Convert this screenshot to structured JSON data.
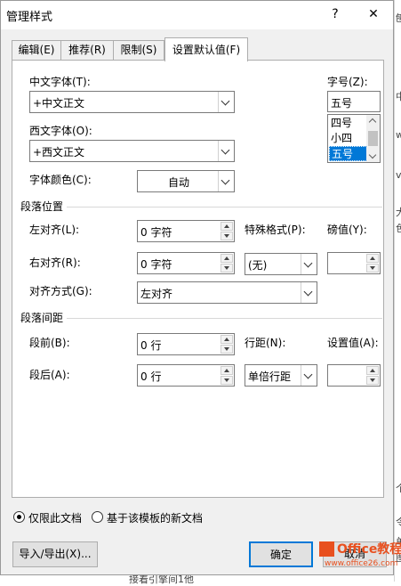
{
  "background_doc": {
    "side_chars": [
      "刨",
      "中",
      "w",
      "v",
      "大",
      "色",
      "个",
      "令",
      "单",
      "图"
    ],
    "bottom_text": "接着引擎间1他"
  },
  "window": {
    "title": "管理样式",
    "help_label": "?",
    "close_label": "✕"
  },
  "tabs": [
    {
      "label": "编辑(E)"
    },
    {
      "label": "推荐(R)"
    },
    {
      "label": "限制(S)"
    },
    {
      "label": "设置默认值(F)"
    }
  ],
  "font": {
    "chinese_font_label": "中文字体(T):",
    "chinese_font_value": "+中文正文",
    "western_font_label": "西文字体(O):",
    "western_font_value": "+西文正文",
    "color_label": "字体颜色(C):",
    "color_value": "自动",
    "size_label": "字号(Z):",
    "size_value": "五号",
    "size_options": [
      "四号",
      "小四",
      "五号"
    ],
    "size_selected": "五号"
  },
  "paragraph_position": {
    "heading": "段落位置",
    "left_indent_label": "左对齐(L):",
    "left_indent_value": "0 字符",
    "right_indent_label": "右对齐(R):",
    "right_indent_value": "0 字符",
    "special_label": "特殊格式(P):",
    "special_value": "(无)",
    "pound_label": "磅值(Y):",
    "pound_value": "",
    "alignment_label": "对齐方式(G):",
    "alignment_value": "左对齐"
  },
  "paragraph_spacing": {
    "heading": "段落间距",
    "before_label": "段前(B):",
    "before_value": "0 行",
    "after_label": "段后(A):",
    "after_value": "0 行",
    "line_spacing_label": "行距(N):",
    "line_spacing_value": "单倍行距",
    "setting_label": "设置值(A):",
    "setting_value": ""
  },
  "scope": {
    "this_doc_label": "仅限此文档",
    "this_doc_selected": true,
    "template_label": "基于该模板的新文档",
    "template_selected": false
  },
  "buttons": {
    "import_export": "导入/导出(X)...",
    "ok": "确定",
    "cancel": "取消"
  },
  "watermark": {
    "brand": "Office教程网",
    "url": "www.office26.com",
    "color": "#e8501f"
  },
  "colors": {
    "accent": "#0078d7"
  }
}
